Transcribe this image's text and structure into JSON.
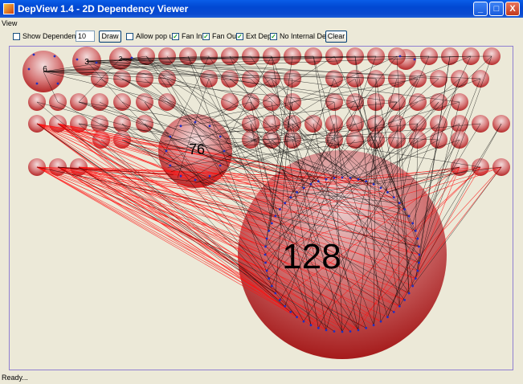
{
  "window": {
    "title": "DepView 1.4 - 2D Dependency Viewer",
    "controls": {
      "minimize": "_",
      "maximize": "□",
      "close": "X"
    }
  },
  "menu": {
    "items": [
      "View"
    ]
  },
  "toolbar": {
    "show_dependency": {
      "label": "Show Dependency",
      "checked": false
    },
    "depth_value": "10",
    "draw_label": "Draw",
    "allow_popup": {
      "label": "Allow pop up",
      "checked": false
    },
    "fan_in": {
      "label": "Fan In",
      "checked": true
    },
    "fan_out": {
      "label": "Fan Out",
      "checked": true
    },
    "ext_dep": {
      "label": "Ext Dep",
      "checked": true
    },
    "no_internal_dep": {
      "label": "No Internal Dep",
      "checked": true
    },
    "clear_label": "Clear"
  },
  "graph": {
    "labels": {
      "big": "128",
      "mid": "76",
      "n1": "6",
      "n2": "3",
      "n3": "2"
    },
    "colors": {
      "node": "#c34848",
      "edge_black": "#000000",
      "edge_red": "#ff1010",
      "port": "#2030c0"
    }
  },
  "status": {
    "text": "Ready..."
  }
}
